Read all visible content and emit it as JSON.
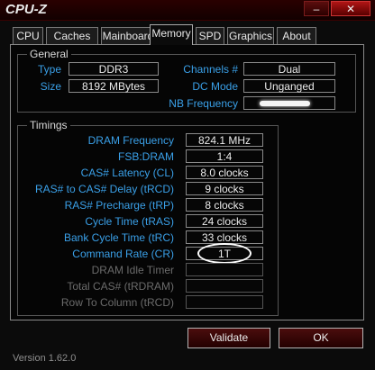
{
  "app": {
    "title": "CPU-Z"
  },
  "window_controls": {
    "minimize": "–",
    "close": "✕"
  },
  "tabs": [
    "CPU",
    "Caches",
    "Mainboard",
    "Memory",
    "SPD",
    "Graphics",
    "About"
  ],
  "active_tab": "Memory",
  "general": {
    "title": "General",
    "type_label": "Type",
    "type_value": "DDR3",
    "size_label": "Size",
    "size_value": "8192 MBytes",
    "channels_label": "Channels #",
    "channels_value": "Dual",
    "dcmode_label": "DC Mode",
    "dcmode_value": "Unganged",
    "nbfreq_label": "NB Frequency",
    "nbfreq_value": ""
  },
  "timings": {
    "title": "Timings",
    "rows": [
      {
        "label": "DRAM Frequency",
        "value": "824.1 MHz"
      },
      {
        "label": "FSB:DRAM",
        "value": "1:4"
      },
      {
        "label": "CAS# Latency (CL)",
        "value": "8.0 clocks"
      },
      {
        "label": "RAS# to CAS# Delay (tRCD)",
        "value": "9 clocks"
      },
      {
        "label": "RAS# Precharge (tRP)",
        "value": "8 clocks"
      },
      {
        "label": "Cycle Time (tRAS)",
        "value": "24 clocks"
      },
      {
        "label": "Bank Cycle Time (tRC)",
        "value": "33 clocks"
      },
      {
        "label": "Command Rate (CR)",
        "value": "1T"
      },
      {
        "label": "DRAM Idle Timer",
        "value": ""
      },
      {
        "label": "Total CAS# (tRDRAM)",
        "value": ""
      },
      {
        "label": "Row To Column (tRCD)",
        "value": ""
      }
    ]
  },
  "footer": {
    "version": "Version 1.62.0",
    "validate_label": "Validate",
    "ok_label": "OK"
  },
  "colors": {
    "label": "#3aa0e8",
    "accent": "#4b0d0d"
  }
}
